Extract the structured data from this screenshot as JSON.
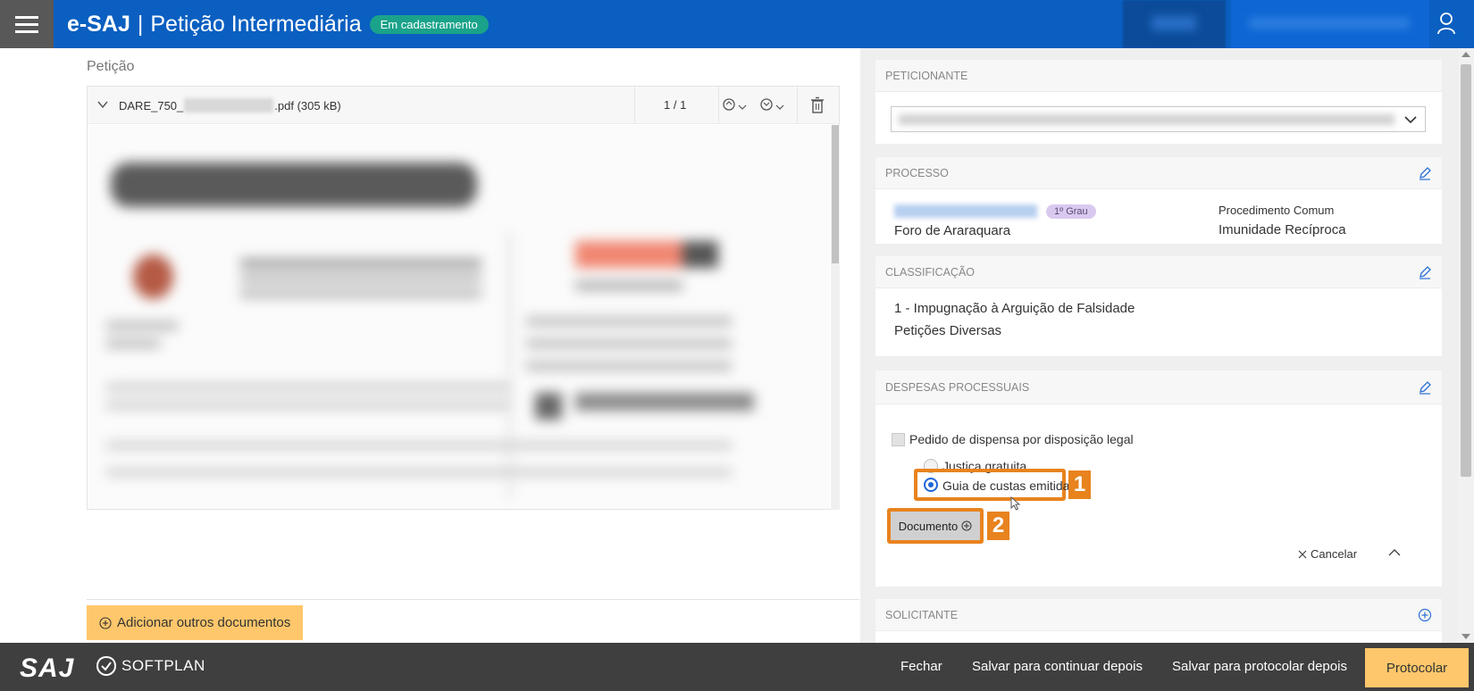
{
  "header": {
    "app_name": "e-SAJ",
    "separator": "|",
    "page_title": "Petição Intermediária",
    "status": "Em cadastramento"
  },
  "left": {
    "section_title": "Petição",
    "document": {
      "name_prefix": "DARE_750_",
      "name_suffix": ".pdf (305 kB)",
      "pages": "1 / 1"
    },
    "add_documents_label": "Adicionar outros documentos"
  },
  "right": {
    "peticionante": {
      "title": "PETICIONANTE"
    },
    "processo": {
      "title": "PROCESSO",
      "grau": "1º Grau",
      "foro": "Foro de Araraquara",
      "procedimento": "Procedimento Comum",
      "classe": "Imunidade Recíproca"
    },
    "classificacao": {
      "title": "CLASSIFICAÇÃO",
      "line1": "1 - Impugnação à Arguição de Falsidade",
      "line2": "Petições Diversas"
    },
    "despesas": {
      "title": "DESPESAS PROCESSUAIS",
      "checkbox_label": "Pedido de dispensa por disposição legal",
      "radio_justica": "Justiça gratuita",
      "radio_guia": "Guia de custas emitida",
      "selected": "Guia de custas emitida",
      "badge_1": "1",
      "badge_2": "2",
      "document_button": "Documento",
      "cancel_label": "Cancelar"
    },
    "solicitante": {
      "title": "SOLICITANTE"
    }
  },
  "footer": {
    "saj_logo": "SAJ",
    "softplan_logo": "SOFTPLAN",
    "fechar": "Fechar",
    "salvar_continuar": "Salvar para continuar depois",
    "salvar_protocolar": "Salvar para protocolar depois",
    "protocolar": "Protocolar"
  },
  "colors": {
    "header_blue": "#0a5fc1",
    "status_green": "#1aa38a",
    "accent_orange": "#ffc76b",
    "highlight_orange": "#e8831e",
    "footer_dark": "#3f3f3f"
  }
}
